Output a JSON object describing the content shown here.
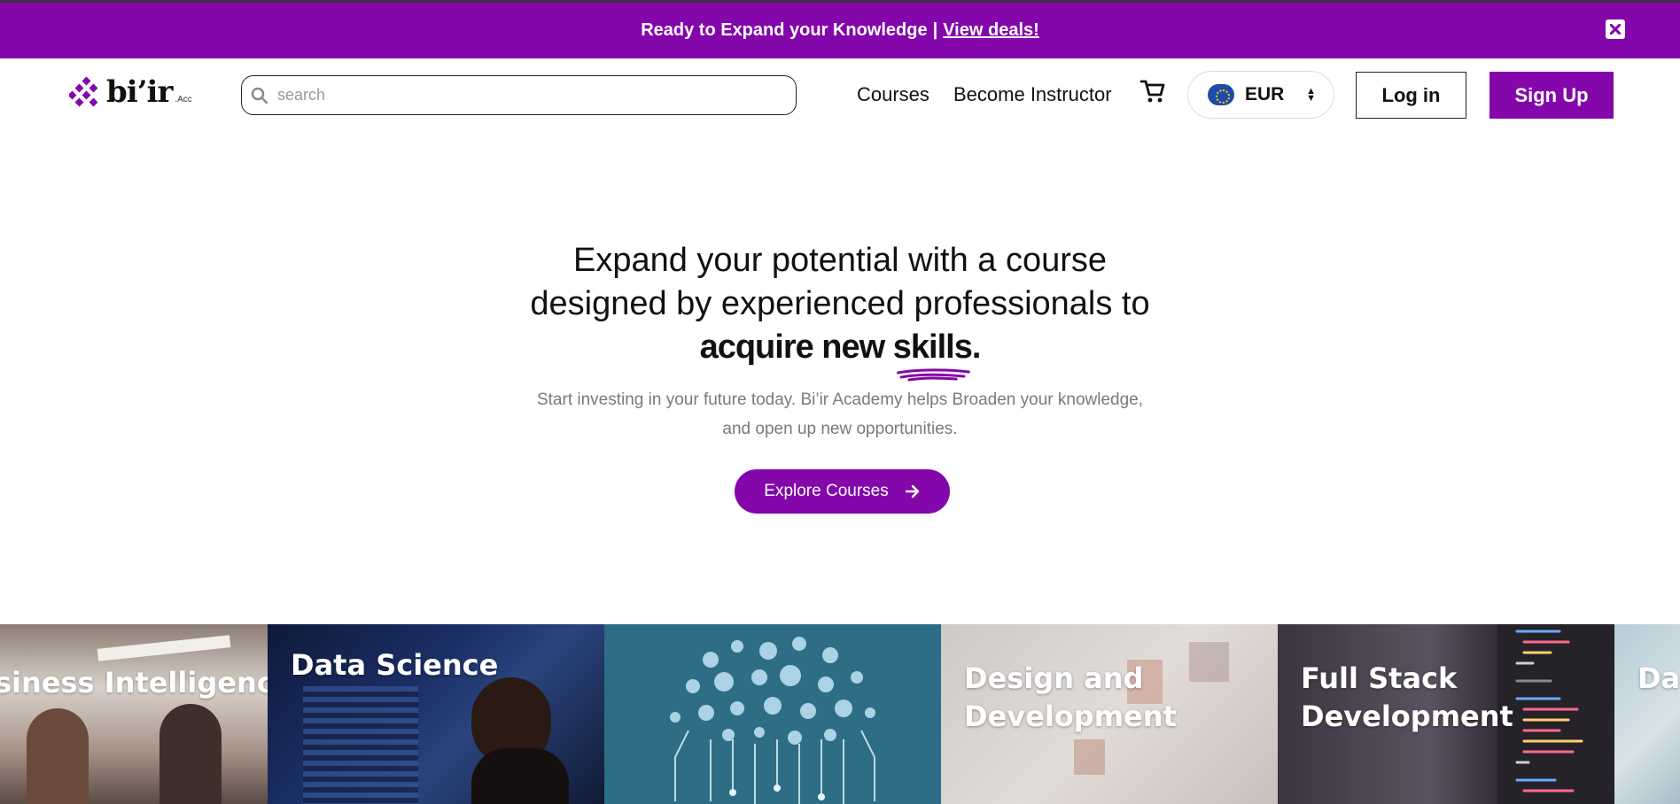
{
  "promo": {
    "text": "Ready to Expand your Knowledge",
    "separator": "|",
    "link": "View deals!",
    "close_icon": "close-icon"
  },
  "header": {
    "logo_text": "bi’ir",
    "logo_sub": ".Acc",
    "search_placeholder": "search",
    "search_value": "",
    "nav": {
      "courses": "Courses",
      "become_instructor": "Become Instructor"
    },
    "cart_icon": "cart-icon",
    "currency": {
      "label": "EUR",
      "flag_icon": "eu-flag-icon"
    },
    "login_label": "Log in",
    "signup_label": "Sign Up"
  },
  "hero": {
    "line1": "Expand your potential with a course",
    "line2": "designed by experienced professionals to",
    "strong_a": "acquire new ",
    "strong_b": "skills",
    "strong_c": ".",
    "sub1": "Start investing in your future today. Bi’ir Academy helps Broaden your knowledge,",
    "sub2": "and open up new opportunities.",
    "cta": "Explore Courses"
  },
  "categories": [
    {
      "title": "siness Intelligence"
    },
    {
      "title": "Data Science"
    },
    {
      "title": ""
    },
    {
      "title": "Design and Development"
    },
    {
      "title": "Full Stack Development"
    },
    {
      "title": "Da"
    }
  ],
  "colors": {
    "brand": "#8407ab",
    "text": "#111111",
    "muted": "#7a7a7a"
  }
}
